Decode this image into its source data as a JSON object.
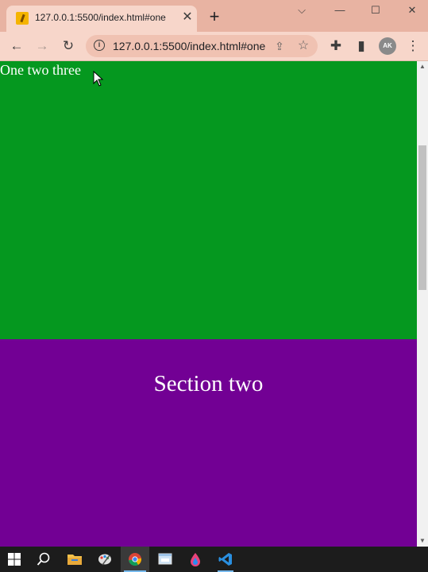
{
  "browser": {
    "tab": {
      "title": "127.0.0.1:5500/index.html#one",
      "close_glyph": "✕"
    },
    "new_tab_glyph": "+",
    "window_controls": {
      "tab_search": "⌵",
      "minimize": "—",
      "maximize": "☐",
      "close": "✕"
    },
    "toolbar": {
      "back_glyph": "←",
      "forward_glyph": "→",
      "reload_glyph": "↻",
      "info_glyph": "i",
      "url": "127.0.0.1:5500/index.html#one",
      "share_glyph": "⇪",
      "star_glyph": "☆",
      "extensions_glyph": "✚",
      "side_panel_glyph": "▮",
      "avatar_initials": "AK",
      "menu_glyph": "⋮"
    }
  },
  "page": {
    "section_one": {
      "text": "One two three",
      "color": "#05981f"
    },
    "section_two": {
      "text": "Section two",
      "color": "#720094"
    },
    "scrollbar": {
      "up_glyph": "▲",
      "down_glyph": "▼"
    }
  },
  "taskbar": {
    "icons": [
      "windows-start-icon",
      "search-icon",
      "file-explorer-icon",
      "paint-icon",
      "chrome-icon",
      "app-window-icon",
      "color-drop-icon",
      "vscode-icon"
    ]
  }
}
